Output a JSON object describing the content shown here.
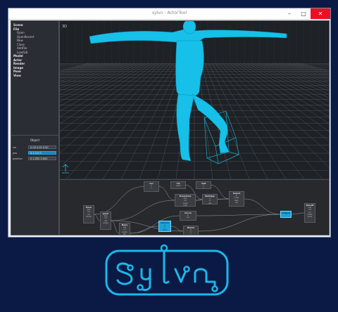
{
  "window": {
    "title": "sylvn - ActorTool",
    "minimize_glyph": "–",
    "maximize_glyph": "□",
    "close_glyph": "✕"
  },
  "sidebar": {
    "menu": [
      {
        "label": "Scene",
        "level": 0
      },
      {
        "label": "File",
        "level": 0
      },
      {
        "label": "Open",
        "level": 1
      },
      {
        "label": "OpenRecent",
        "level": 1
      },
      {
        "label": "New",
        "level": 1
      },
      {
        "label": "Close",
        "level": 1
      },
      {
        "label": "AddFile",
        "level": 1
      },
      {
        "label": "LoadLib",
        "level": 1
      },
      {
        "label": "Model",
        "level": 0
      },
      {
        "label": "Actor",
        "level": 0
      },
      {
        "label": "Render",
        "level": 0
      },
      {
        "label": "Image",
        "level": 0
      },
      {
        "label": "Pose",
        "level": 0
      },
      {
        "label": "View",
        "level": 0
      }
    ],
    "object_panel": {
      "title": "Object",
      "fields": [
        {
          "label": "rot",
          "value": "0.00 0.00 0.00"
        },
        {
          "label": "pos",
          "value": "0.1 0.0 0"
        },
        {
          "label": "position",
          "value": "0 1.052 0.000"
        }
      ]
    }
  },
  "viewport": {
    "corner_label": "3D",
    "mesh_color": "#16c0e8",
    "grid_color": "#7e8690"
  },
  "node_editor": {
    "nodes": [
      {
        "title": "vec",
        "params": [
          "x",
          "y"
        ]
      },
      {
        "title": "rot",
        "params": [
          "quat"
        ]
      },
      {
        "title": "mat",
        "params": [
          "x",
          "y"
        ]
      },
      {
        "title": "Transform",
        "params": [
          "pos",
          "rot",
          "scale",
          "mat"
        ]
      },
      {
        "title": "Multiply",
        "params": [
          "a",
          "b",
          "out"
        ]
      },
      {
        "title": "Select",
        "params": [
          "in",
          "index",
          "item",
          "out"
        ]
      },
      {
        "title": "Pose",
        "params": [
          "pos",
          "rot",
          "scl",
          "bones"
        ]
      },
      {
        "title": "Joint",
        "params": [
          "pos",
          "rot",
          "ref",
          "angle"
        ]
      },
      {
        "title": "Bone",
        "params": [
          "pos",
          "rot",
          "angle",
          "len",
          "parent"
        ]
      },
      {
        "title": "Curve",
        "params": [
          "in",
          "out"
        ]
      },
      {
        "title": "Source",
        "params": [
          "a",
          "b",
          "time"
        ]
      },
      {
        "title": "Blend",
        "params": [
          "a",
          "b",
          "w",
          "out"
        ]
      },
      {
        "title": "Output",
        "params": [
          "x"
        ]
      },
      {
        "title": "Result",
        "params": [
          "pos",
          "rot",
          "scl",
          "mesh",
          "pose"
        ]
      }
    ]
  },
  "logo": {
    "text": "Sylvn",
    "color": "#1ab8e8"
  }
}
